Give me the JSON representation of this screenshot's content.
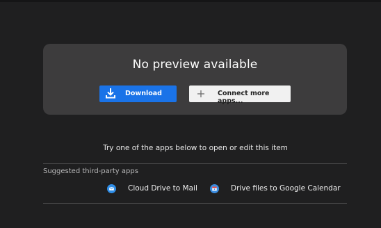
{
  "preview": {
    "title": "No preview available",
    "download_label": "Download",
    "connect_label": "Connect more apps..."
  },
  "hint": "Try one of the apps below to open or edit this item",
  "suggested": {
    "heading": "Suggested third-party apps",
    "apps": [
      {
        "label": "Cloud Drive to Mail",
        "icon": "mail-icon",
        "color": "#2f8ee8"
      },
      {
        "label": "Drive files to Google Calendar",
        "icon": "calendar-icon",
        "color": "#3b8de0"
      }
    ]
  },
  "colors": {
    "background": "#1f1f20",
    "card": "#3d3c3d",
    "accent": "#1a73e8"
  }
}
